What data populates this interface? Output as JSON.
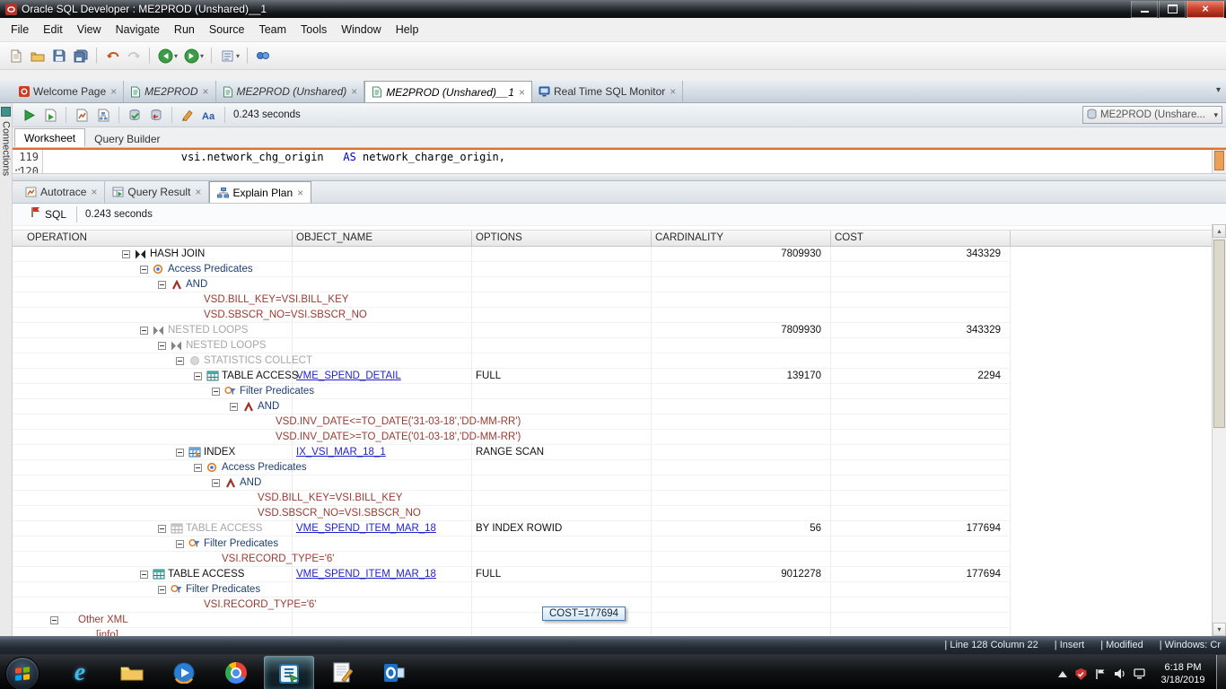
{
  "window": {
    "title": "Oracle SQL Developer : ME2PROD (Unshared)__1"
  },
  "menu": {
    "items": [
      "File",
      "Edit",
      "View",
      "Navigate",
      "Run",
      "Source",
      "Team",
      "Tools",
      "Window",
      "Help"
    ]
  },
  "main_toolbar": {
    "icons": [
      "new-file",
      "open-file",
      "save",
      "save-all",
      "undo",
      "redo",
      "navigate-back",
      "navigate-forward",
      "worksheet",
      "reports"
    ]
  },
  "doc_tabs": {
    "tabs": [
      {
        "label": "Welcome Page",
        "icon": "welcome-icon",
        "active": false,
        "italic": false
      },
      {
        "label": "ME2PROD",
        "icon": "worksheet-icon",
        "active": false,
        "italic": true
      },
      {
        "label": "ME2PROD (Unshared)",
        "icon": "worksheet-icon",
        "active": false,
        "italic": true
      },
      {
        "label": "ME2PROD (Unshared)__1",
        "icon": "worksheet-icon",
        "active": true,
        "italic": true
      },
      {
        "label": "Real Time SQL Monitor",
        "icon": "monitor-icon",
        "active": false,
        "italic": false
      }
    ]
  },
  "connections_panel": {
    "label": "Connections"
  },
  "worksheet_toolbar": {
    "icons": [
      "run-statement",
      "run-script",
      "autotrace",
      "explain-plan",
      "commit",
      "rollback",
      "clear",
      "to-uppercase"
    ],
    "timer": "0.243 seconds",
    "connection": {
      "label": "ME2PROD (Unshare..."
    }
  },
  "worksheet_tabs": {
    "tabs": [
      "Worksheet",
      "Query Builder"
    ]
  },
  "editor": {
    "line_numbers": [
      "119",
      "120"
    ],
    "code_pre": "                     vsi.network_chg_origin   ",
    "keyword": "AS",
    "code_post": " network_charge_origin,"
  },
  "result_tabs": {
    "tabs": [
      {
        "label": "Autotrace",
        "icon": "autotrace-icon",
        "active": false
      },
      {
        "label": "Query Result",
        "icon": "query-result-icon",
        "active": false
      },
      {
        "label": "Explain Plan",
        "icon": "explain-plan-icon",
        "active": true
      }
    ]
  },
  "explain_toolbar": {
    "sql_label": "SQL",
    "timer": "0.243 seconds"
  },
  "plan": {
    "columns": [
      "OPERATION",
      "OBJECT_NAME",
      "OPTIONS",
      "CARDINALITY",
      "COST"
    ],
    "rows": [
      {
        "level": 5,
        "expand": "minus",
        "icon": "join",
        "label": "HASH JOIN",
        "style": "normal",
        "cardinality": "7809930",
        "cost": "343329"
      },
      {
        "level": 6,
        "expand": "minus",
        "icon": "access",
        "label": "Access Predicates",
        "style": "predlabel"
      },
      {
        "level": 7,
        "expand": "minus",
        "icon": "and",
        "label": "AND",
        "style": "predlabel"
      },
      {
        "level": 8,
        "expand": "none",
        "icon": "",
        "label": "VSD.BILL_KEY=VSI.BILL_KEY",
        "style": "pred"
      },
      {
        "level": 8,
        "expand": "none",
        "icon": "",
        "label": "VSD.SBSCR_NO=VSI.SBSCR_NO",
        "style": "pred"
      },
      {
        "level": 6,
        "expand": "minus",
        "icon": "join",
        "label": "NESTED LOOPS",
        "style": "gray",
        "cardinality": "7809930",
        "cost": "343329"
      },
      {
        "level": 7,
        "expand": "minus",
        "icon": "join",
        "label": "NESTED LOOPS",
        "style": "gray"
      },
      {
        "level": 8,
        "expand": "minus",
        "icon": "stats",
        "label": "STATISTICS COLLECT",
        "style": "gray"
      },
      {
        "level": 9,
        "expand": "minus",
        "icon": "table",
        "label": "TABLE ACCESS",
        "style": "normal",
        "object": "VME_SPEND_DETAIL",
        "options": "FULL",
        "cardinality": "139170",
        "cost": "2294"
      },
      {
        "level": 10,
        "expand": "minus",
        "icon": "filter",
        "label": "Filter Predicates",
        "style": "predlabel"
      },
      {
        "level": 11,
        "expand": "minus",
        "icon": "and",
        "label": "AND",
        "style": "predlabel"
      },
      {
        "level": 12,
        "expand": "none",
        "icon": "",
        "label": "VSD.INV_DATE<=TO_DATE('31-03-18','DD-MM-RR')",
        "style": "pred"
      },
      {
        "level": 12,
        "expand": "none",
        "icon": "",
        "label": "VSD.INV_DATE>=TO_DATE('01-03-18','DD-MM-RR')",
        "style": "pred"
      },
      {
        "level": 8,
        "expand": "minus",
        "icon": "index",
        "label": "INDEX",
        "style": "normal",
        "object": "IX_VSI_MAR_18_1",
        "options": "RANGE SCAN"
      },
      {
        "level": 9,
        "expand": "minus",
        "icon": "access",
        "label": "Access Predicates",
        "style": "predlabel"
      },
      {
        "level": 10,
        "expand": "minus",
        "icon": "and",
        "label": "AND",
        "style": "predlabel"
      },
      {
        "level": 11,
        "expand": "none",
        "icon": "",
        "label": "VSD.BILL_KEY=VSI.BILL_KEY",
        "style": "pred"
      },
      {
        "level": 11,
        "expand": "none",
        "icon": "",
        "label": "VSD.SBSCR_NO=VSI.SBSCR_NO",
        "style": "pred"
      },
      {
        "level": 7,
        "expand": "minus",
        "icon": "table",
        "label": "TABLE ACCESS",
        "style": "gray",
        "object": "VME_SPEND_ITEM_MAR_18",
        "options": "BY INDEX ROWID",
        "cardinality": "56",
        "cost": "177694"
      },
      {
        "level": 8,
        "expand": "minus",
        "icon": "filter",
        "label": "Filter Predicates",
        "style": "predlabel"
      },
      {
        "level": 9,
        "expand": "none",
        "icon": "",
        "label": "VSI.RECORD_TYPE='6'",
        "style": "pred"
      },
      {
        "level": 6,
        "expand": "minus",
        "icon": "table",
        "label": "TABLE ACCESS",
        "style": "normal",
        "object": "VME_SPEND_ITEM_MAR_18",
        "options": "FULL",
        "cardinality": "9012278",
        "cost": "177694"
      },
      {
        "level": 7,
        "expand": "minus",
        "icon": "filter",
        "label": "Filter Predicates",
        "style": "predlabel"
      },
      {
        "level": 8,
        "expand": "none",
        "icon": "",
        "label": "VSI.RECORD_TYPE='6'",
        "style": "pred"
      },
      {
        "level": 1,
        "expand": "minus",
        "icon": "",
        "label": "Other XML",
        "style": "xml"
      },
      {
        "level": 2,
        "expand": "none",
        "icon": "",
        "label": "[info]",
        "style": "xmllink"
      }
    ]
  },
  "tooltip": {
    "text": "COST=177694"
  },
  "status_bar": {
    "segments": [
      "Line 128 Column 22",
      "Insert",
      "Modified",
      "Windows: Cr"
    ]
  },
  "taskbar": {
    "apps": [
      {
        "name": "internet-explorer",
        "active": false
      },
      {
        "name": "windows-explorer",
        "active": false
      },
      {
        "name": "media-player",
        "active": false
      },
      {
        "name": "chrome",
        "active": false
      },
      {
        "name": "sql-developer",
        "active": true
      },
      {
        "name": "text-editor",
        "active": false
      },
      {
        "name": "outlook",
        "active": false
      }
    ],
    "tray_icons": [
      "hidden-icons",
      "antivirus",
      "action-center",
      "volume",
      "network"
    ],
    "clock": {
      "time": "6:18 PM",
      "date": "3/18/2019"
    }
  }
}
